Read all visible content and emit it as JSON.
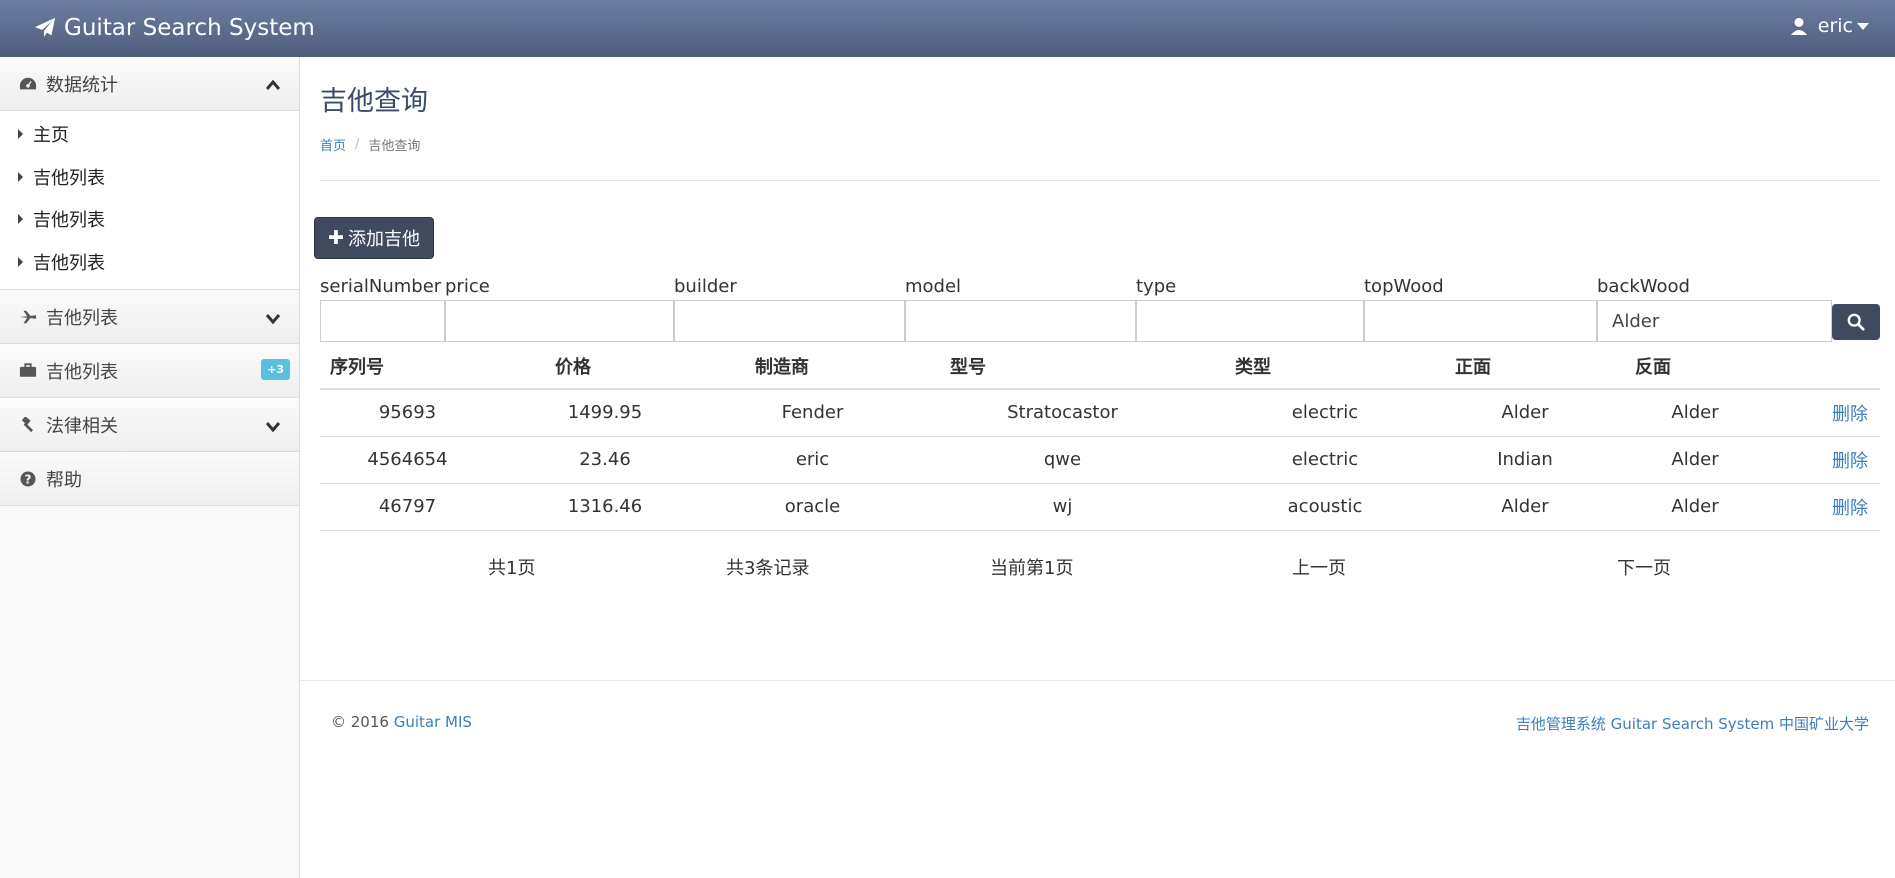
{
  "header": {
    "brand": "Guitar Search System",
    "user": "eric"
  },
  "sidebar": {
    "sections": [
      {
        "label": "数据统计",
        "expanded": true,
        "icon": "dashboard-icon",
        "items": [
          {
            "label": "主页"
          },
          {
            "label": "吉他列表"
          },
          {
            "label": "吉他列表"
          },
          {
            "label": "吉他列表"
          }
        ]
      },
      {
        "label": "吉他列表",
        "icon": "plane-icon"
      },
      {
        "label": "吉他列表",
        "icon": "briefcase-icon",
        "badge": "+3"
      },
      {
        "label": "法律相关",
        "icon": "gavel-icon"
      },
      {
        "label": "帮助",
        "icon": "question-circle-icon"
      }
    ]
  },
  "page": {
    "title": "吉他查询",
    "breadcrumb": {
      "home": "首页",
      "current": "吉他查询"
    },
    "add_button": "添加吉他"
  },
  "filters": {
    "labels": [
      "serialNumber",
      "price",
      "builder",
      "model",
      "type",
      "topWood",
      "backWood"
    ],
    "values": [
      "",
      "",
      "",
      "",
      "",
      "",
      "Alder"
    ]
  },
  "table": {
    "headers": [
      "序列号",
      "价格",
      "制造商",
      "型号",
      "类型",
      "正面",
      "反面"
    ],
    "delete_label": "删除",
    "rows": [
      [
        "95693",
        "1499.95",
        "Fender",
        "Stratocastor",
        "electric",
        "Alder",
        "Alder"
      ],
      [
        "4564654",
        "23.46",
        "eric",
        "qwe",
        "electric",
        "Indian",
        "Alder"
      ],
      [
        "46797",
        "1316.46",
        "oracle",
        "wj",
        "acoustic",
        "Alder",
        "Alder"
      ]
    ]
  },
  "pagination": {
    "total_pages": "共1页",
    "total_records": "共3条记录",
    "current": "当前第1页",
    "prev": "上一页",
    "next": "下一页"
  },
  "footer": {
    "copyright": "© 2016",
    "brand_link": "Guitar MIS",
    "right_text": "吉他管理系统 Guitar Search System 中国矿业大学"
  },
  "colors": {
    "header_top": "#6d7ea0",
    "header_bottom": "#4e5d7e",
    "button": "#3f4a5e",
    "link": "#3a7ebf",
    "badge": "#5bc0de"
  }
}
